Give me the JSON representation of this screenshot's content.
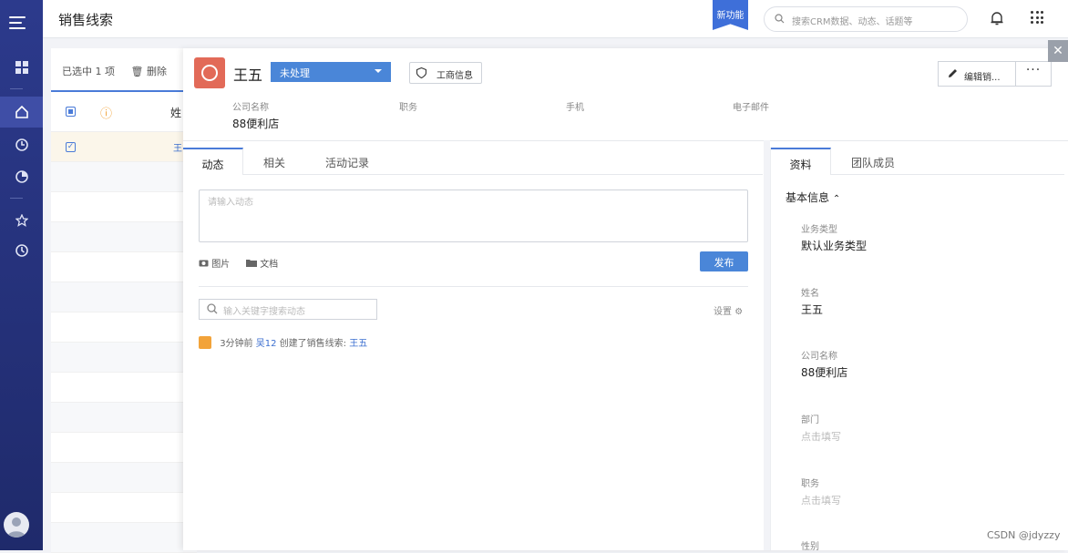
{
  "topbar": {
    "title": "销售线索",
    "new_feature": "新功能",
    "search_placeholder": "搜索CRM数据、动态、话题等"
  },
  "list": {
    "selected_text": "已选中 1 项",
    "delete_label": "删除",
    "name_col": "姓",
    "row_name": "王"
  },
  "detail": {
    "name": "王五",
    "status": "未处理",
    "biz_button": "工商信息",
    "edit_button": "编辑销...",
    "more_button": "···",
    "fields": [
      {
        "label": "公司名称",
        "value": "88便利店"
      },
      {
        "label": "职务",
        "value": ""
      },
      {
        "label": "手机",
        "value": ""
      },
      {
        "label": "电子邮件",
        "value": ""
      }
    ],
    "close_label": "✕"
  },
  "center": {
    "tabs": [
      "动态",
      "相关",
      "活动记录"
    ],
    "input_placeholder": "请输入动态",
    "image_label": "图片",
    "doc_label": "文档",
    "publish_label": "发布",
    "keyword_placeholder": "输入关键字搜索动态",
    "settings_label": "设置",
    "activity": {
      "time": "3分钟前",
      "user": "吴12",
      "action": "创建了销售线索:",
      "target": "王五"
    }
  },
  "right": {
    "tabs": [
      "资料",
      "团队成员"
    ],
    "section": "基本信息",
    "items": [
      {
        "label": "业务类型",
        "value": "默认业务类型"
      },
      {
        "label": "姓名",
        "value": "王五"
      },
      {
        "label": "公司名称",
        "value": "88便利店"
      },
      {
        "label": "部门",
        "value": "点击填写"
      },
      {
        "label": "职务",
        "value": "点击填写"
      },
      {
        "label": "性别",
        "value": ""
      }
    ]
  },
  "watermark": "CSDN @jdyzzy",
  "colors": {
    "nav": "#2c3a8c",
    "accent": "#4a86d8",
    "logo": "#e26a58"
  }
}
